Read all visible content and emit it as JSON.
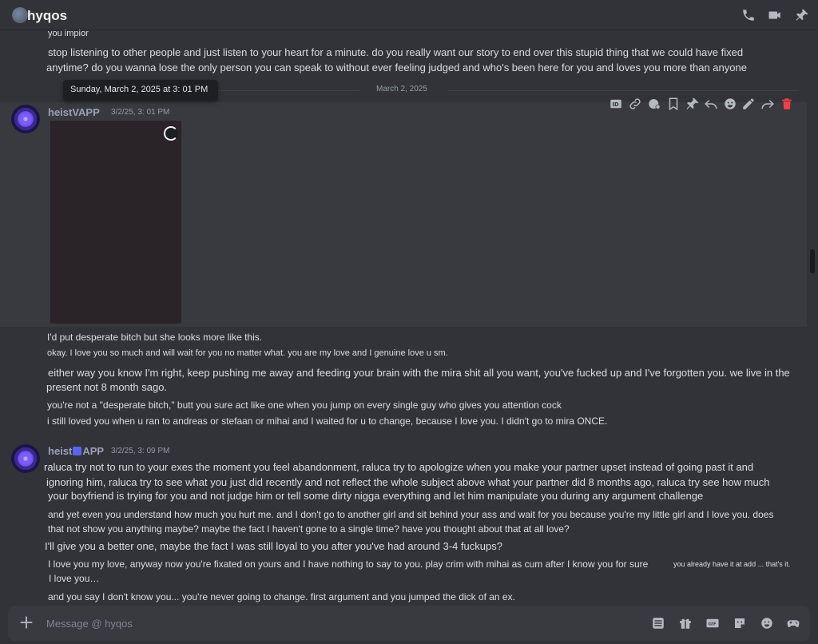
{
  "header": {
    "title": "hyqos",
    "icons": [
      "phone-icon",
      "video-icon",
      "pin-icon"
    ]
  },
  "messages_top": {
    "cut": "you impior",
    "line1": "stop listening to other people and just listen to your heart for a minute. do you really want our story to end over this stupid thing that we could have fixed",
    "line2": "anytime? do you wanna lose the only person you can speak to without ever feeling judged and who's been here for you and loves you more than anyone"
  },
  "tooltip": "Sunday, March 2, 2025 at 3: 01 PM",
  "date_divider": "March 2, 2025",
  "group1": {
    "username": "heistVAPP",
    "timestamp": "3/2/25, 3: 01 PM"
  },
  "toolbar": [
    "id-icon",
    "link-icon",
    "thread-icon",
    "bookmark-icon",
    "pin-icon",
    "reply-icon",
    "emoji-icon",
    "edit-icon",
    "forward-icon",
    "delete-icon"
  ],
  "messages_mid": [
    "I'd put desperate bitch but she looks more like this.",
    "okay. I love you so much and will wait for you no matter what. you are my love and I genuine love u sm.",
    "either way you know I'm right, keep pushing me away and feeding your brain with the mira shit all you want, you've fucked up and I've forgotten you. we live in the",
    "present not 8 month sago.",
    "you're not a \"desperate bitch,\" butt you sure act like one when you jump on every single guy who gives you attention cock",
    "i still loved you when u ran to andreas or stefaan or mihai and I waited for u to change, because I love you. I didn't go to mira ONCE."
  ],
  "group2": {
    "username_a": "heist",
    "username_b": "APP",
    "timestamp": "3/2/25, 3: 09 PM"
  },
  "messages_bottom": [
    "raluca try not to run to your exes the moment you feel abandonment, raluca try to apologize when you make your partner upset instead of going past it and",
    "ignoring him, raluca try to see what you just did recently and not reflect the whole subject above what your partner did 8 months ago, raluca try see how much",
    "your boyfriend is trying for you and not judge him or tell some dirty nigga everything and let him manipulate you during any argument challenge",
    "and yet even you understand how much you hurt me. and I don't go to another girl and sit behind your ass and wait for you because you're my little girl and I love you. does",
    "that not show you anything maybe? maybe the fact I haven't gone to a single time? have you thought about that at all love?",
    "I'll give you a better one, maybe the fact I was still loyal to you after you've had around 3-4 fuckups?",
    "I love you my love, anyway now you're fixated on yours and I have nothing to say to you. play crim with mihai as cum after I know you for sure",
    "you already have it at add ... that's it.",
    "I love you…",
    "and you say I don't know you... you're never going to change. first argument and you jumped the dick of an ex."
  ],
  "composer": {
    "placeholder": "Message @ hyqos",
    "icons": [
      "apps-icon",
      "gift-icon",
      "gif-icon",
      "sticker-icon",
      "emoji-icon",
      "activities-icon"
    ]
  },
  "colors": {
    "background": "#313338",
    "hover": "#383a40",
    "delete": "#f23f43",
    "accent": "#5865f2"
  }
}
